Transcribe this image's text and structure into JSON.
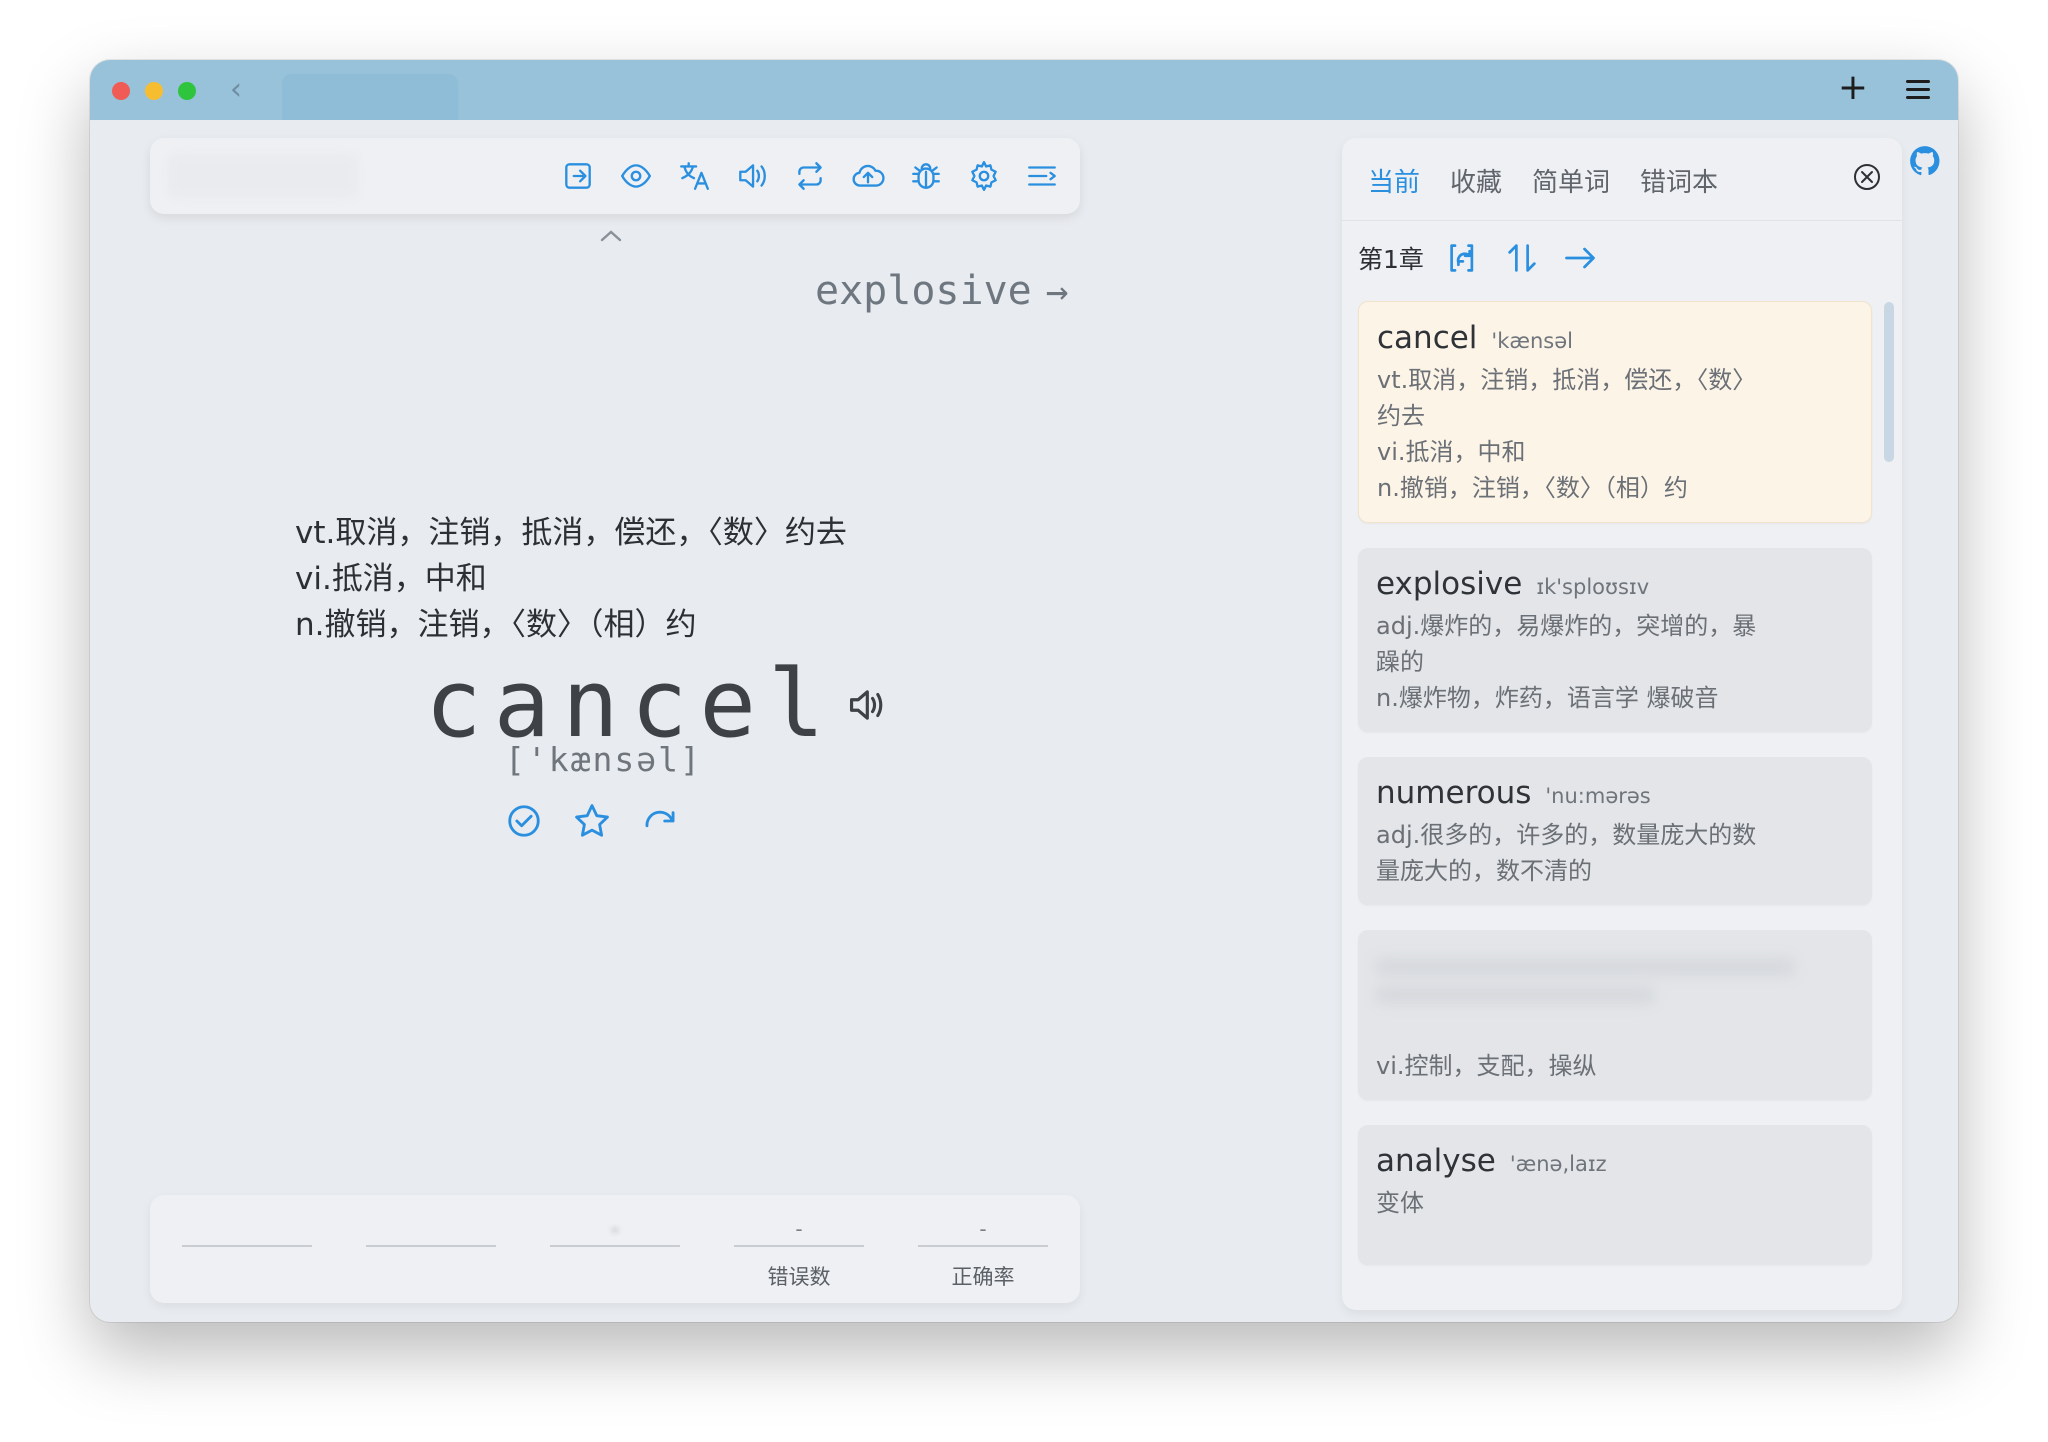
{
  "toolbar": {
    "icons": [
      "exit-icon",
      "eye-icon",
      "translate-icon",
      "speaker-icon",
      "repeat-icon",
      "upload-icon",
      "bug-icon",
      "gear-icon",
      "list-icon"
    ]
  },
  "main": {
    "next_word": "explosive",
    "next_arrow": "→",
    "definitions": [
      "vt.取消，注销，抵消，偿还，〈数〉约去",
      "vi.抵消，中和",
      "n.撤销，注销，〈数〉（相）约"
    ],
    "word": "cancel",
    "phonetic": "['kænsəl]"
  },
  "stats": [
    {
      "value": "",
      "label": ""
    },
    {
      "value": "",
      "label": ""
    },
    {
      "value": "-",
      "label": ""
    },
    {
      "value": "-",
      "label": "错误数"
    },
    {
      "value": "-",
      "label": "正确率"
    }
  ],
  "panel": {
    "tabs": [
      "当前",
      "收藏",
      "简单词",
      "错词本"
    ],
    "chapter": "第1章",
    "words": [
      {
        "word": "cancel",
        "phonetic": "'kænsəl",
        "trans": [
          "vt.取消，注销，抵消，偿还，〈数〉",
          "约去",
          "vi.抵消，中和",
          "n.撤销，注销，〈数〉（相）约"
        ],
        "current": true
      },
      {
        "word": "explosive",
        "phonetic": "ɪk'sploʊsɪv",
        "trans": [
          "adj.爆炸的，易爆炸的，突增的，暴",
          "躁的",
          "n.爆炸物，炸药，语言学 爆破音"
        ],
        "current": false
      },
      {
        "word": "numerous",
        "phonetic": "'nu:mərəs",
        "trans": [
          "adj.很多的，许多的，数量庞大的数",
          "量庞大的，数不清的"
        ],
        "current": false
      },
      {
        "word": "",
        "phonetic": "",
        "trans": [
          "vi.控制，支配，操纵"
        ],
        "current": false
      },
      {
        "word": "analyse",
        "phonetic": "'ænə,laɪz",
        "trans": [
          "变体"
        ],
        "current": false
      }
    ]
  },
  "colors": {
    "accent": "#2b8fe0",
    "titlebar": "#97c2da",
    "current_card": "#fdf4e8"
  }
}
